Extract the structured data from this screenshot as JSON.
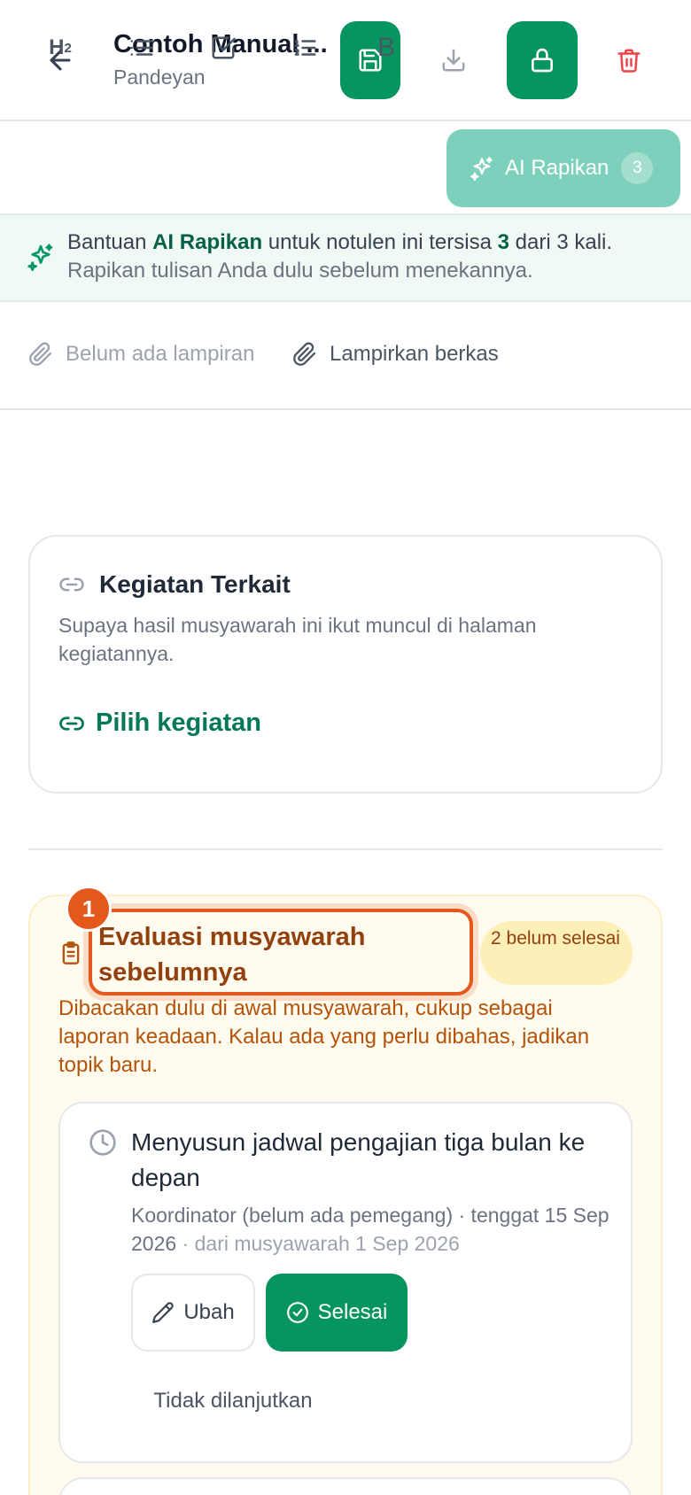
{
  "header": {
    "title": "Contoh Manual ...",
    "subtitle": "Pandeyan"
  },
  "toolbar": {
    "heading_label": "H",
    "heading_sub": "2",
    "bold_label": "B",
    "ai_label": "AI Rapikan",
    "ai_count": "3"
  },
  "banner": {
    "part1": "Bantuan ",
    "brand": "AI Rapikan",
    "part2": " untuk notulen ini tersisa ",
    "remaining": "3",
    "part3": " dari 3 kali.",
    "line2": "Rapikan tulisan Anda dulu sebelum menekannya."
  },
  "attachments": {
    "empty_label": "Belum ada lampiran",
    "add_label": "Lampirkan berkas"
  },
  "related": {
    "title": "Kegiatan Terkait",
    "description": "Supaya hasil musyawarah ini ikut muncul di halaman kegiatannya.",
    "pick_label": "Pilih kegiatan"
  },
  "evaluation": {
    "step": "1",
    "title": "Evaluasi musyawarah sebelumnya",
    "pending_badge": "2 belum selesai",
    "description": "Dibacakan dulu di awal musyawarah, cukup sebagai laporan keadaan. Kalau ada yang perlu dibahas, jadikan topik baru.",
    "item": {
      "title": "Menyusun jadwal pengajian tiga bulan ke depan",
      "meta_main": "Koordinator (belum ada pemegang) · tenggat 15 Sep 2026",
      "meta_source": " · dari musyawarah 1 Sep 2026",
      "edit_label": "Ubah",
      "done_label": "Selesai",
      "discontinue_label": "Tidak dilanjutkan"
    }
  },
  "colors": {
    "primary": "#07955f",
    "ai_button": "#7dd0bb",
    "danger": "#ef4444",
    "highlight": "#e4581b",
    "amber_text": "#b45309"
  }
}
